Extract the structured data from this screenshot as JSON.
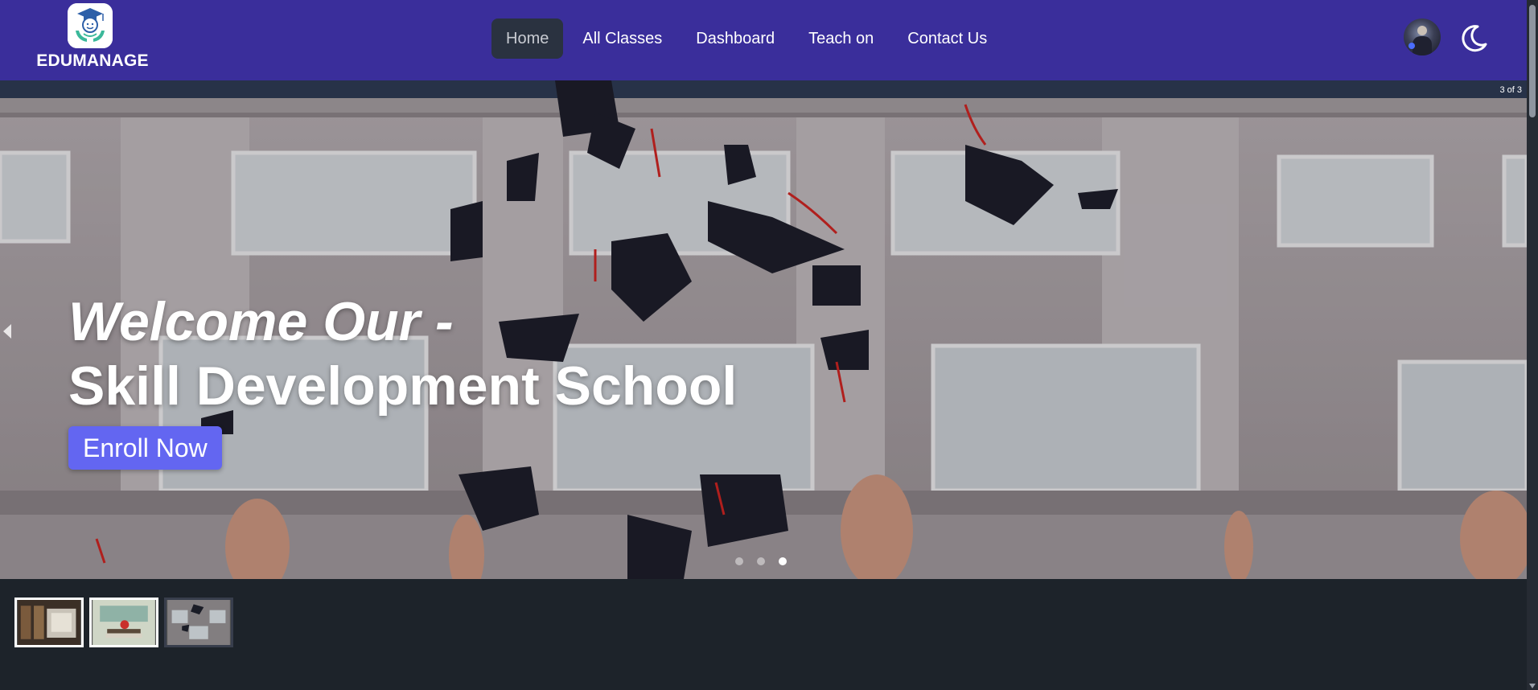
{
  "brand": {
    "name": "EDUMANAGE",
    "logo_icon": "graduate-logo-icon"
  },
  "nav": {
    "items": [
      {
        "label": "Home",
        "active": true
      },
      {
        "label": "All Classes",
        "active": false
      },
      {
        "label": "Dashboard",
        "active": false
      },
      {
        "label": "Teach on",
        "active": false
      },
      {
        "label": "Contact Us",
        "active": false
      }
    ]
  },
  "user": {
    "avatar_icon": "user-avatar",
    "theme_icon": "moon-icon"
  },
  "hero": {
    "slide_counter": "3 of 3",
    "line1": "Welcome Our -",
    "line2": "Skill Development School",
    "cta_label": "Enroll Now",
    "current_slide": 3,
    "total_slides": 3
  },
  "thumbnails": [
    {
      "name": "library-thumbnail",
      "selected": false
    },
    {
      "name": "books-apple-thumbnail",
      "selected": true
    },
    {
      "name": "graduation-caps-thumbnail",
      "selected": false
    }
  ],
  "colors": {
    "navbar": "#3a2e9b",
    "cta": "#6366f1",
    "page_bg": "#1d232a",
    "active_nav_bg": "#2a3240"
  }
}
